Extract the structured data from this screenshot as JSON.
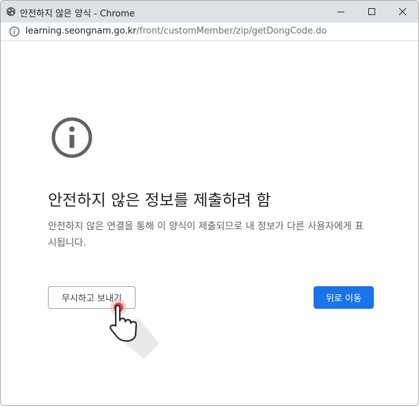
{
  "window": {
    "title": "안전하지 않은 양식 - Chrome"
  },
  "address": {
    "host": "learning.seongnam.go.kr",
    "path": "/front/customMember/zip/getDongCode.do"
  },
  "page": {
    "heading": "안전하지 않은 정보를 제출하려 함",
    "description": "안전하지 않은 연결을 통해 이 양식이 제출되므로 내 정보가 다른 사용자에게 표시됩니다.",
    "send_anyway_label": "무시하고 보내기",
    "go_back_label": "뒤로 이동"
  },
  "icons": {
    "app": "chrome-globe-icon",
    "minimize": "minimize-icon",
    "maximize": "maximize-icon",
    "close": "close-icon",
    "site_info": "info-circle-icon",
    "warning": "info-circle-icon",
    "pointer": "hand-pointer-cursor"
  },
  "colors": {
    "titlebar": "#dee1e6",
    "primary_button": "#1a73e8",
    "icon": "#5f6368",
    "click_indicator": "#e8454a"
  }
}
